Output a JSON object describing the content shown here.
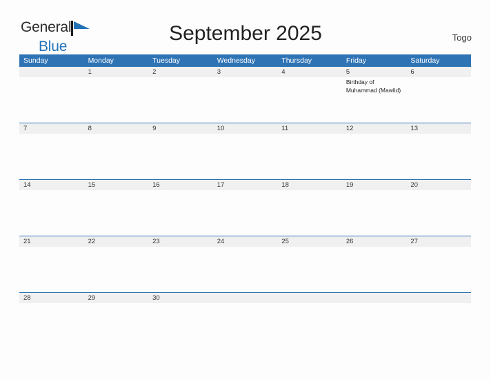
{
  "brand": {
    "name_part1": "General",
    "name_part2": "Blue",
    "flag_icon": "flag-icon",
    "primary_color": "#2272b8"
  },
  "header": {
    "title": "September 2025",
    "locale": "Togo"
  },
  "calendar": {
    "accent_color": "#2e74b5",
    "band_color": "#f0f0f0",
    "weekdays": [
      "Sunday",
      "Monday",
      "Tuesday",
      "Wednesday",
      "Thursday",
      "Friday",
      "Saturday"
    ],
    "weeks": [
      [
        {
          "date": ""
        },
        {
          "date": "1"
        },
        {
          "date": "2"
        },
        {
          "date": "3"
        },
        {
          "date": "4"
        },
        {
          "date": "5",
          "events": [
            "Birthday of Muhammad (Mawlid)"
          ]
        },
        {
          "date": "6"
        }
      ],
      [
        {
          "date": "7"
        },
        {
          "date": "8"
        },
        {
          "date": "9"
        },
        {
          "date": "10"
        },
        {
          "date": "11"
        },
        {
          "date": "12"
        },
        {
          "date": "13"
        }
      ],
      [
        {
          "date": "14"
        },
        {
          "date": "15"
        },
        {
          "date": "16"
        },
        {
          "date": "17"
        },
        {
          "date": "18"
        },
        {
          "date": "19"
        },
        {
          "date": "20"
        }
      ],
      [
        {
          "date": "21"
        },
        {
          "date": "22"
        },
        {
          "date": "23"
        },
        {
          "date": "24"
        },
        {
          "date": "25"
        },
        {
          "date": "26"
        },
        {
          "date": "27"
        }
      ],
      [
        {
          "date": "28"
        },
        {
          "date": "29"
        },
        {
          "date": "30"
        },
        {
          "date": ""
        },
        {
          "date": ""
        },
        {
          "date": ""
        },
        {
          "date": ""
        }
      ]
    ]
  }
}
